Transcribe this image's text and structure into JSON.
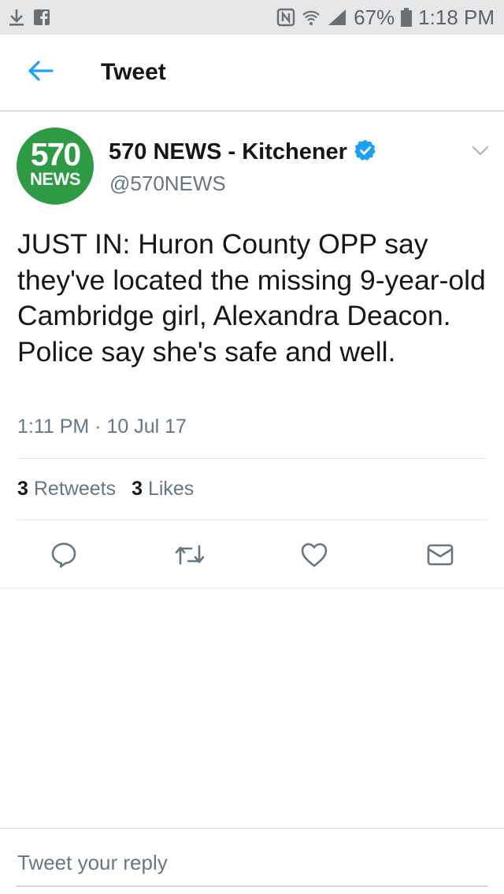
{
  "status_bar": {
    "battery": "67%",
    "time": "1:18 PM",
    "icons": [
      "download-icon",
      "facebook-icon",
      "nfc-icon",
      "wifi-icon",
      "signal-icon",
      "battery-icon"
    ]
  },
  "header": {
    "title": "Tweet"
  },
  "tweet": {
    "avatar_number": "570",
    "avatar_word": "NEWS",
    "author_name": "570 NEWS - Kitchener",
    "handle": "@570NEWS",
    "text": "JUST IN: Huron County OPP say they've located the missing 9-year-old Cambridge girl, Alexandra Deacon. Police say she's safe and well.",
    "time": "1:11 PM · 10 Jul 17",
    "retweet_count": "3",
    "retweet_label": "Retweets",
    "like_count": "3",
    "like_label": "Likes"
  },
  "reply": {
    "placeholder": "Tweet your reply"
  },
  "colors": {
    "accent": "#1da1f2",
    "avatar_green": "#2e9b44",
    "secondary_text": "#657786",
    "icon_gray": "#657786"
  }
}
